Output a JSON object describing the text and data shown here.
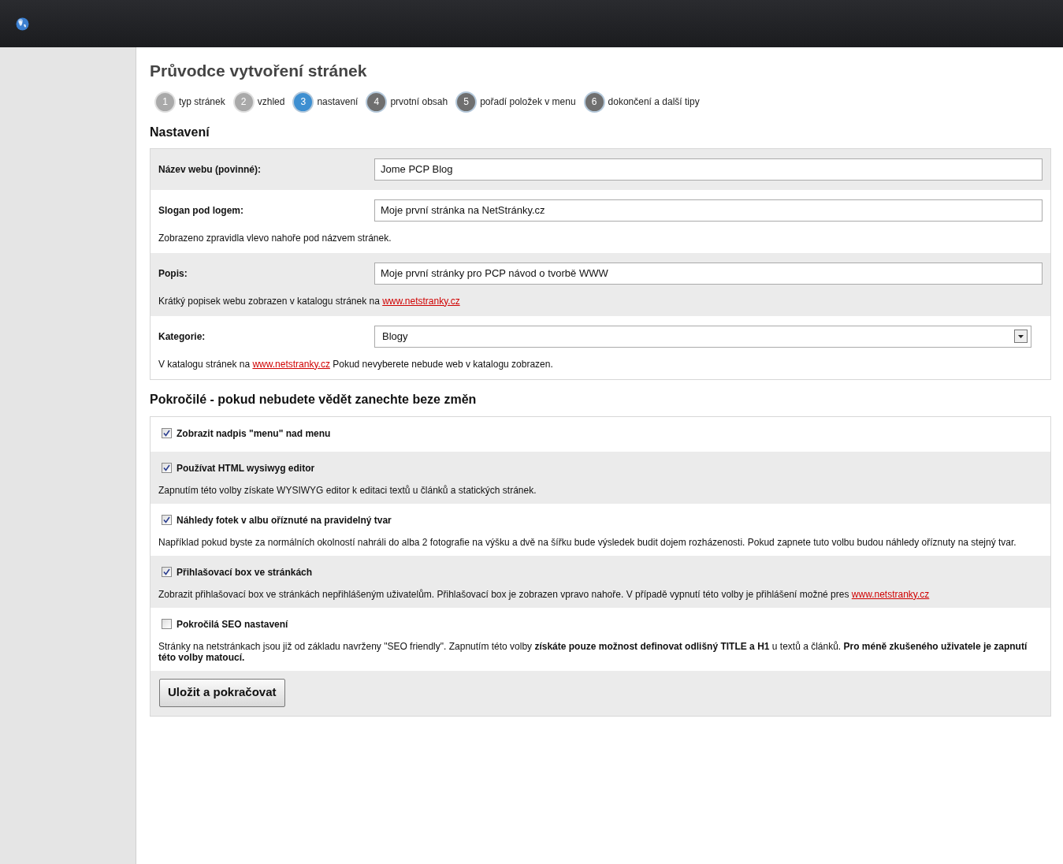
{
  "title": "Průvodce vytvoření stránek",
  "steps": [
    {
      "number": "1",
      "label": "typ stránek",
      "selected": false,
      "done": true
    },
    {
      "number": "2",
      "label": "vzhled",
      "selected": false,
      "done": true
    },
    {
      "number": "3",
      "label": "nastavení",
      "selected": true,
      "done": false
    },
    {
      "number": "4",
      "label": "prvotní obsah",
      "selected": false,
      "done": false
    },
    {
      "number": "5",
      "label": "pořadí položek v menu",
      "selected": false,
      "done": false
    },
    {
      "number": "6",
      "label": "dokončení a další tipy",
      "selected": false,
      "done": false
    }
  ],
  "settings_heading": "Nastavení",
  "fields": [
    {
      "label": "Název webu (povinné):",
      "kind": "input",
      "value": "Jome PCP Blog"
    },
    {
      "label": "Slogan pod logem:",
      "kind": "input",
      "value": "Moje první stránka na NetStránky.cz",
      "help": [
        {
          "kind": "text",
          "text": "Zobrazeno zpravidla vlevo nahoře pod názvem stránek."
        }
      ]
    },
    {
      "label": "Popis:",
      "kind": "input",
      "value": "Moje první stránky pro PCP návod o tvorbě WWW",
      "help": [
        {
          "kind": "text",
          "text": "Krátký popisek webu zobrazen v katalogu stránek na "
        },
        {
          "kind": "link",
          "text": "www.netstranky.cz"
        }
      ]
    },
    {
      "label": "Kategorie:",
      "kind": "select",
      "value": "Blogy",
      "help": [
        {
          "kind": "text",
          "text": "V katalogu stránek na "
        },
        {
          "kind": "link",
          "text": "www.netstranky.cz"
        },
        {
          "kind": "text",
          "text": " Pokud nevyberete nebude web v katalogu zobrazen."
        }
      ]
    }
  ],
  "advanced_heading": "Pokročilé - pokud nebudete vědět zanechte beze změn",
  "options": [
    {
      "label": "Zobrazit nadpis \"menu\" nad menu",
      "checked": true
    },
    {
      "label": "Používat HTML wysiwyg editor",
      "checked": true,
      "help": [
        {
          "kind": "text",
          "text": "Zapnutím této volby získate WYSIWYG editor k editaci textů u článků a statických stránek."
        }
      ]
    },
    {
      "label": "Náhledy fotek v albu oříznuté na pravidelný tvar",
      "checked": true,
      "help": [
        {
          "kind": "text",
          "text": "Například pokud byste za normálních okolností nahráli do alba 2 fotografie na výšku a dvě na šířku bude výsledek budit dojem rozházenosti. Pokud zapnete tuto volbu budou náhledy oříznuty na stejný tvar."
        }
      ]
    },
    {
      "label": "Přihlašovací box ve stránkách",
      "checked": true,
      "help": [
        {
          "kind": "text",
          "text": "Zobrazit přihlašovací box ve stránkách nepřihlášeným uživatelům. Přihlašovací box je zobrazen vpravo nahoře. V případě vypnutí této volby je přihlášení možné pres "
        },
        {
          "kind": "link",
          "text": "www.netstranky.cz"
        }
      ]
    },
    {
      "label": "Pokročilá SEO nastavení",
      "checked": false,
      "help": [
        {
          "kind": "text",
          "text": "Stránky na netstránkach jsou již od základu navrženy \"SEO friendly\". Zapnutím této volby **získáte pouze možnost definovat odlišný TITLE a H1** u textů a článků. **Pro méně zkušeného uživatele je zapnutí této volby matoucí.**"
        }
      ]
    }
  ],
  "submit_button": "Uložit a pokračovat"
}
